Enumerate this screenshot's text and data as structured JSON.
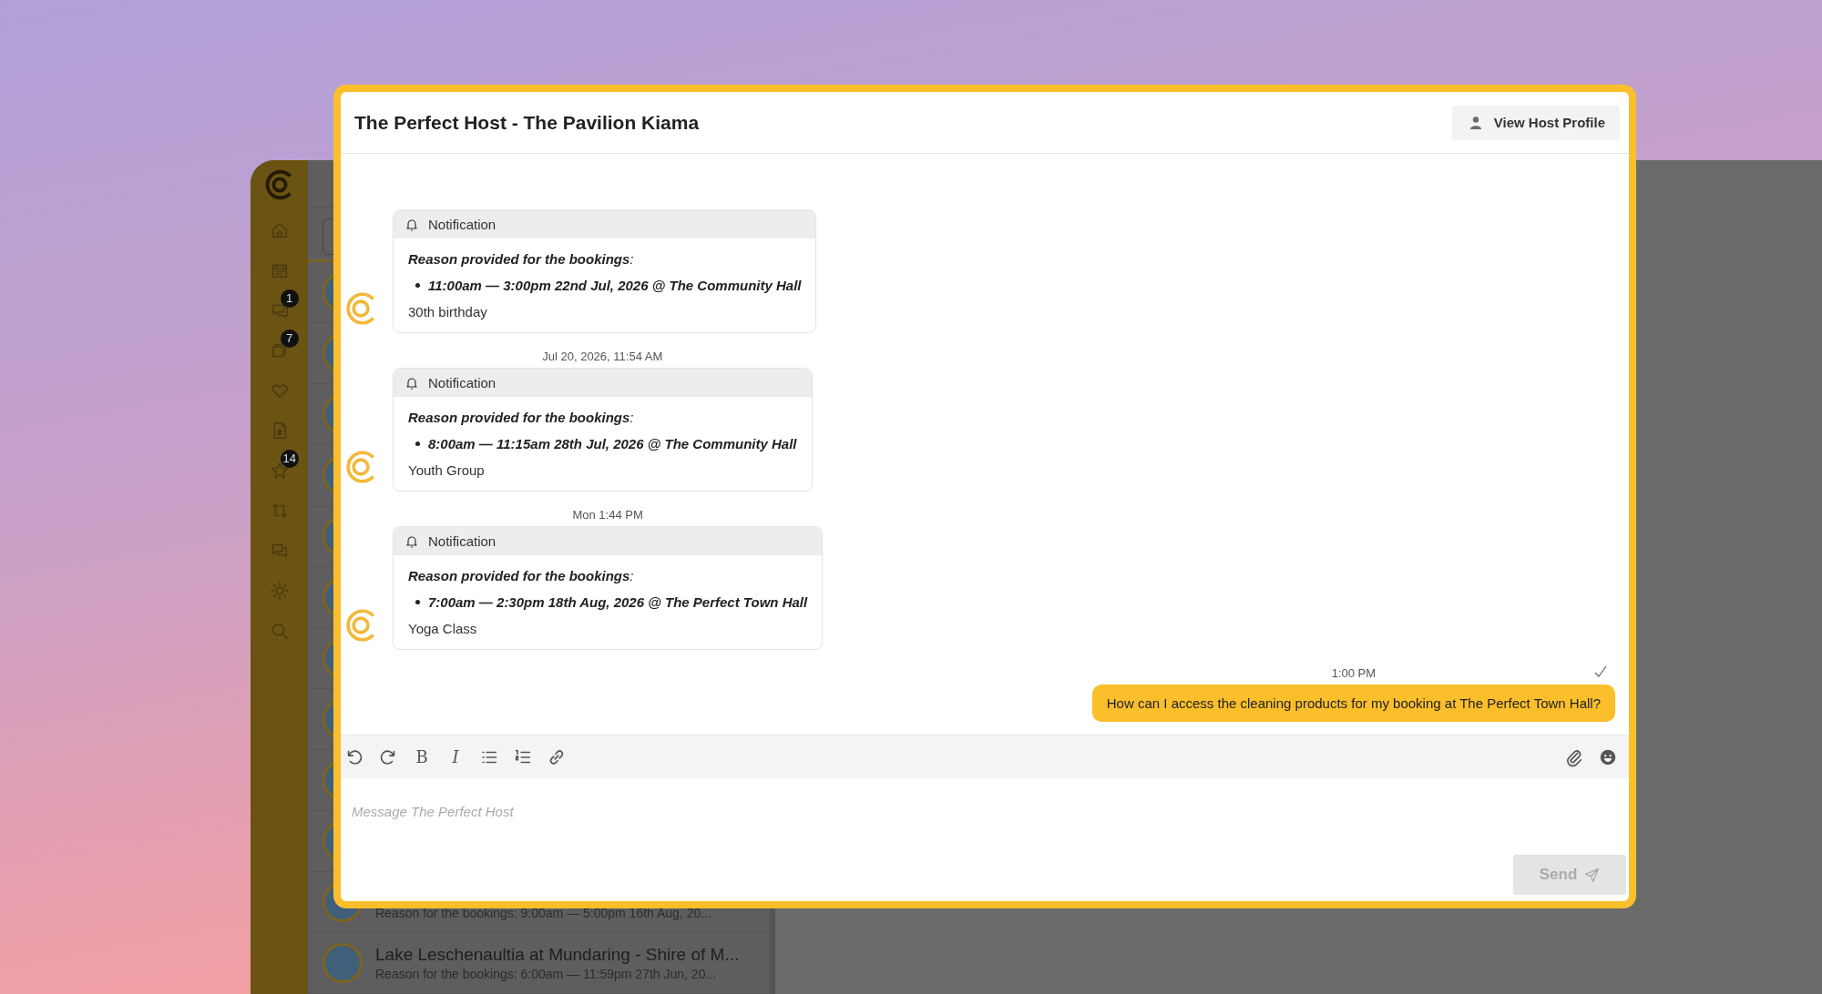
{
  "background_app": {
    "sidebar": {
      "items": [
        {
          "kind": "home"
        },
        {
          "kind": "calendar"
        },
        {
          "kind": "chat",
          "badge": "1"
        },
        {
          "kind": "folder",
          "badge": "7"
        },
        {
          "kind": "heart"
        },
        {
          "kind": "invoice"
        },
        {
          "kind": "star",
          "badge": "14"
        },
        {
          "kind": "swap"
        },
        {
          "kind": "chats"
        },
        {
          "kind": "settings"
        },
        {
          "kind": "search"
        }
      ]
    },
    "conversations": [
      {
        "subtitle": "Reason for the bookings: 9:00am — 5:00pm 16th Aug, 20..."
      },
      {
        "title": "Lake Leschenaultia at Mundaring - Shire of M...",
        "subtitle": "Reason for the bookings: 6:00am — 11:59pm 27th Jun, 20..."
      }
    ]
  },
  "chat": {
    "title": "The Perfect Host - The Pavilion Kiama",
    "profile_button": "View Host Profile",
    "messages": [
      {
        "kind": "notification",
        "header": "Notification",
        "reason": "**Reason provided for the bookings**:",
        "bookings": [
          "11:00am — 3:00pm 22nd Jul, 2026 @ The Community Hall"
        ],
        "note": "30th birthday"
      },
      {
        "kind": "notification",
        "timestamp": "Jul 20, 2026, 11:54 AM",
        "header": "Notification",
        "reason": "**Reason provided for the bookings**:",
        "bookings": [
          "8:00am — 11:15am 28th Jul, 2026 @ The Community Hall"
        ],
        "note": "Youth Group"
      },
      {
        "kind": "notification",
        "timestamp": "Mon 1:44 PM",
        "header": "Notification",
        "reason": "**Reason provided for the bookings**:",
        "bookings": [
          "7:00am — 2:30pm 18th Aug, 2026 @ The Perfect Town Hall"
        ],
        "note": "Yoga Class"
      },
      {
        "kind": "outgoing",
        "timestamp": "1:00 PM",
        "text": "How can I access the cleaning products for my booking at The Perfect Town Hall?",
        "read": true
      }
    ],
    "toolbar": {
      "left": [
        {
          "kind": "undo"
        },
        {
          "kind": "redo"
        },
        {
          "kind": "bold",
          "label": "B"
        },
        {
          "kind": "italic",
          "label": "I"
        },
        {
          "kind": "bullets"
        },
        {
          "kind": "numbers"
        },
        {
          "kind": "link"
        }
      ],
      "right": [
        {
          "kind": "attach"
        },
        {
          "kind": "emoji"
        }
      ]
    },
    "composer": {
      "placeholder": "Message The Perfect Host",
      "send": "Send",
      "send_disabled": true
    }
  }
}
